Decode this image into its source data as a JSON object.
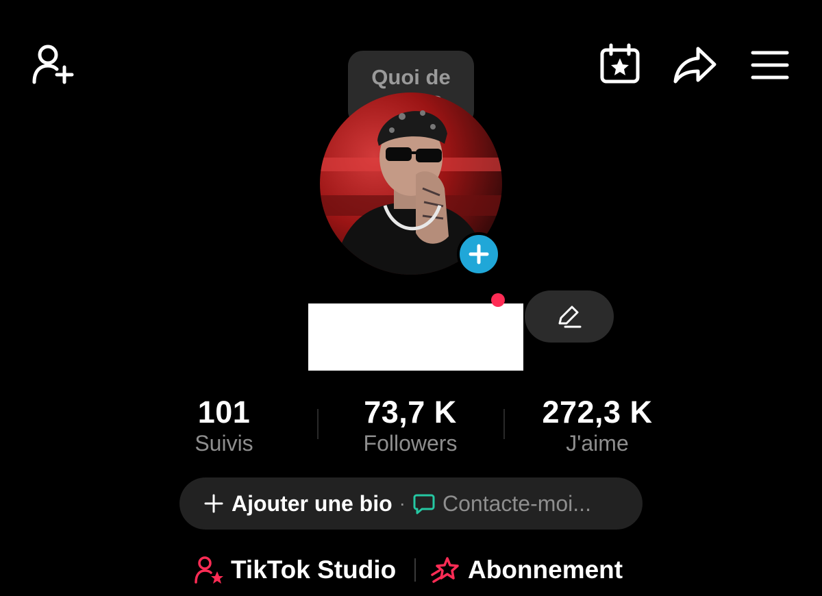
{
  "header": {
    "add_friend_icon": "person-plus-icon",
    "calendar_icon": "calendar-star-icon",
    "share_icon": "share-arrow-icon",
    "menu_icon": "hamburger-menu-icon"
  },
  "story": {
    "prompt": "Quoi de neuf ?"
  },
  "profile": {
    "avatar_add_icon": "plus-icon",
    "edit_icon": "pencil-icon"
  },
  "stats": [
    {
      "value": "101",
      "label": "Suivis"
    },
    {
      "value": "73,7 K",
      "label": "Followers"
    },
    {
      "value": "272,3 K",
      "label": "J'aime"
    }
  ],
  "bio": {
    "add_label": "Ajouter une bio",
    "separator": "·",
    "contact_label": "Contacte-moi..."
  },
  "links": {
    "studio_label": "TikTok Studio",
    "subscription_label": "Abonnement"
  },
  "colors": {
    "background": "#000000",
    "accent_red": "#fe2c55",
    "accent_blue": "#20a7d8",
    "accent_green": "#25c8a3",
    "pill_bg": "#222222"
  }
}
